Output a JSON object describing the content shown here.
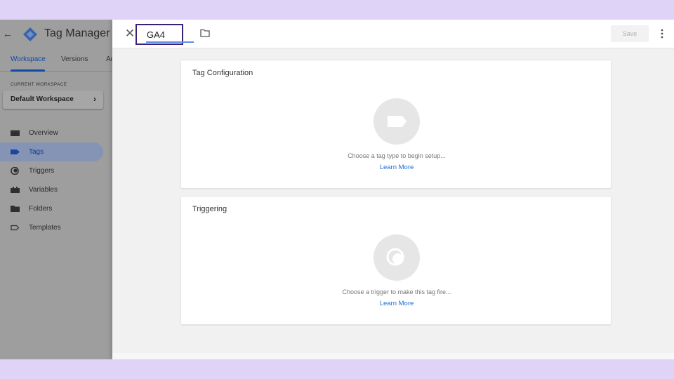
{
  "sidebar": {
    "app_title": "Tag Manager",
    "tabs": [
      {
        "label": "Workspace",
        "active": true
      },
      {
        "label": "Versions",
        "active": false
      },
      {
        "label": "Ac",
        "active": false
      }
    ],
    "workspace_label": "CURRENT WORKSPACE",
    "workspace_name": "Default Workspace",
    "nav": [
      {
        "label": "Overview",
        "icon": "overview-icon",
        "active": false
      },
      {
        "label": "Tags",
        "icon": "tag-icon",
        "active": true
      },
      {
        "label": "Triggers",
        "icon": "trigger-icon",
        "active": false
      },
      {
        "label": "Variables",
        "icon": "variables-icon",
        "active": false
      },
      {
        "label": "Folders",
        "icon": "folder-icon",
        "active": false
      },
      {
        "label": "Templates",
        "icon": "template-icon",
        "active": false
      }
    ]
  },
  "drawer": {
    "tag_name_value": "GA4",
    "save_label": "Save",
    "tag_config": {
      "title": "Tag Configuration",
      "hint": "Choose a tag type to begin setup...",
      "link": "Learn More"
    },
    "triggering": {
      "title": "Triggering",
      "hint": "Choose a trigger to make this tag fire...",
      "link": "Learn More"
    }
  },
  "colors": {
    "accent": "#1a6fd6",
    "highlight_box": "#3a1f78",
    "page_bg": "#dfd3f7"
  }
}
